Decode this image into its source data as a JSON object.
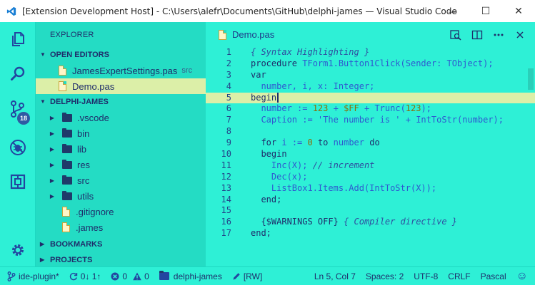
{
  "window": {
    "title": "[Extension Development Host] - C:\\Users\\alefr\\Documents\\GitHub\\delphi-james — Visual Studio Code",
    "minimize_glyph": "—",
    "maximize_glyph": "☐",
    "close_glyph": "✕"
  },
  "activity": {
    "scm_badge": "18"
  },
  "sidebar": {
    "title": "EXPLORER",
    "open_editors_header": "OPEN EDITORS",
    "open_editors": [
      {
        "name": "JamesExpertSettings.pas",
        "desc": "src"
      },
      {
        "name": "Demo.pas",
        "desc": ""
      }
    ],
    "folder_header": "DELPHI-JAMES",
    "tree": [
      {
        "name": ".vscode",
        "type": "folder"
      },
      {
        "name": "bin",
        "type": "folder"
      },
      {
        "name": "lib",
        "type": "folder"
      },
      {
        "name": "res",
        "type": "folder"
      },
      {
        "name": "src",
        "type": "folder"
      },
      {
        "name": "utils",
        "type": "folder"
      },
      {
        "name": ".gitignore",
        "type": "file"
      },
      {
        "name": ".james",
        "type": "file"
      }
    ],
    "bookmarks_header": "BOOKMARKS",
    "projects_header": "PROJECTS"
  },
  "editor": {
    "tab_label": "Demo.pas",
    "current_line": 5,
    "lines": [
      {
        "n": "1",
        "tokens": [
          {
            "t": "{ Syntax Highlighting }",
            "c": "cmt"
          }
        ]
      },
      {
        "n": "2",
        "tokens": [
          {
            "t": "procedure ",
            "c": "kw"
          },
          {
            "t": "TForm1.Button1Click(Sender: TObject);",
            "c": "fn"
          }
        ]
      },
      {
        "n": "3",
        "tokens": [
          {
            "t": "var",
            "c": "kw"
          }
        ]
      },
      {
        "n": "4",
        "tokens": [
          {
            "t": "  number, i, x: Integer;",
            "c": "fn"
          }
        ]
      },
      {
        "n": "5",
        "tokens": [
          {
            "t": "begin",
            "c": "kw"
          }
        ]
      },
      {
        "n": "6",
        "tokens": [
          {
            "t": "  number := ",
            "c": "fn"
          },
          {
            "t": "123",
            "c": "num"
          },
          {
            "t": " + ",
            "c": "fn"
          },
          {
            "t": "$FF",
            "c": "num"
          },
          {
            "t": " + Trunc(",
            "c": "fn"
          },
          {
            "t": "123",
            "c": "num"
          },
          {
            "t": ");",
            "c": "fn"
          }
        ]
      },
      {
        "n": "7",
        "tokens": [
          {
            "t": "  Caption := ",
            "c": "fn"
          },
          {
            "t": "'The number is '",
            "c": "str"
          },
          {
            "t": " + IntToStr(number);",
            "c": "fn"
          }
        ]
      },
      {
        "n": "8",
        "tokens": []
      },
      {
        "n": "9",
        "tokens": [
          {
            "t": "  for ",
            "c": "kw"
          },
          {
            "t": "i",
            "c": "fn"
          },
          {
            "t": " := ",
            "c": "fn"
          },
          {
            "t": "0",
            "c": "num"
          },
          {
            "t": " to ",
            "c": "kw"
          },
          {
            "t": "number",
            "c": "fn"
          },
          {
            "t": " do",
            "c": "kw"
          }
        ]
      },
      {
        "n": "10",
        "tokens": [
          {
            "t": "  begin",
            "c": "kw"
          }
        ]
      },
      {
        "n": "11",
        "tokens": [
          {
            "t": "    Inc(X); ",
            "c": "fn"
          },
          {
            "t": "// increment",
            "c": "cmt"
          }
        ]
      },
      {
        "n": "12",
        "tokens": [
          {
            "t": "    Dec(x);",
            "c": "fn"
          }
        ]
      },
      {
        "n": "13",
        "tokens": [
          {
            "t": "    ListBox1.Items.Add(IntToStr(X));",
            "c": "fn"
          }
        ]
      },
      {
        "n": "14",
        "tokens": [
          {
            "t": "  end;",
            "c": "kw"
          }
        ]
      },
      {
        "n": "15",
        "tokens": []
      },
      {
        "n": "16",
        "tokens": [
          {
            "t": "  {$WARNINGS OFF} ",
            "c": "kw"
          },
          {
            "t": "{ Compiler directive }",
            "c": "cmt"
          }
        ]
      },
      {
        "n": "17",
        "tokens": [
          {
            "t": "end;",
            "c": "kw"
          }
        ]
      }
    ]
  },
  "statusbar": {
    "branch": "ide-plugin*",
    "sync": "0↓ 1↑",
    "errors": "0",
    "warnings": "0",
    "folder": "delphi-james",
    "mode": "[RW]",
    "position": "Ln 5, Col 7",
    "spaces": "Spaces: 2",
    "encoding": "UTF-8",
    "eol": "CRLF",
    "language": "Pascal",
    "feedback_glyph": "☺"
  },
  "colors": {
    "background": "#2ef0d6",
    "sidebar": "#24dcc4",
    "selection": "#dcefa8",
    "text": "#1f2d6b",
    "accent": "#2f5ba3"
  }
}
